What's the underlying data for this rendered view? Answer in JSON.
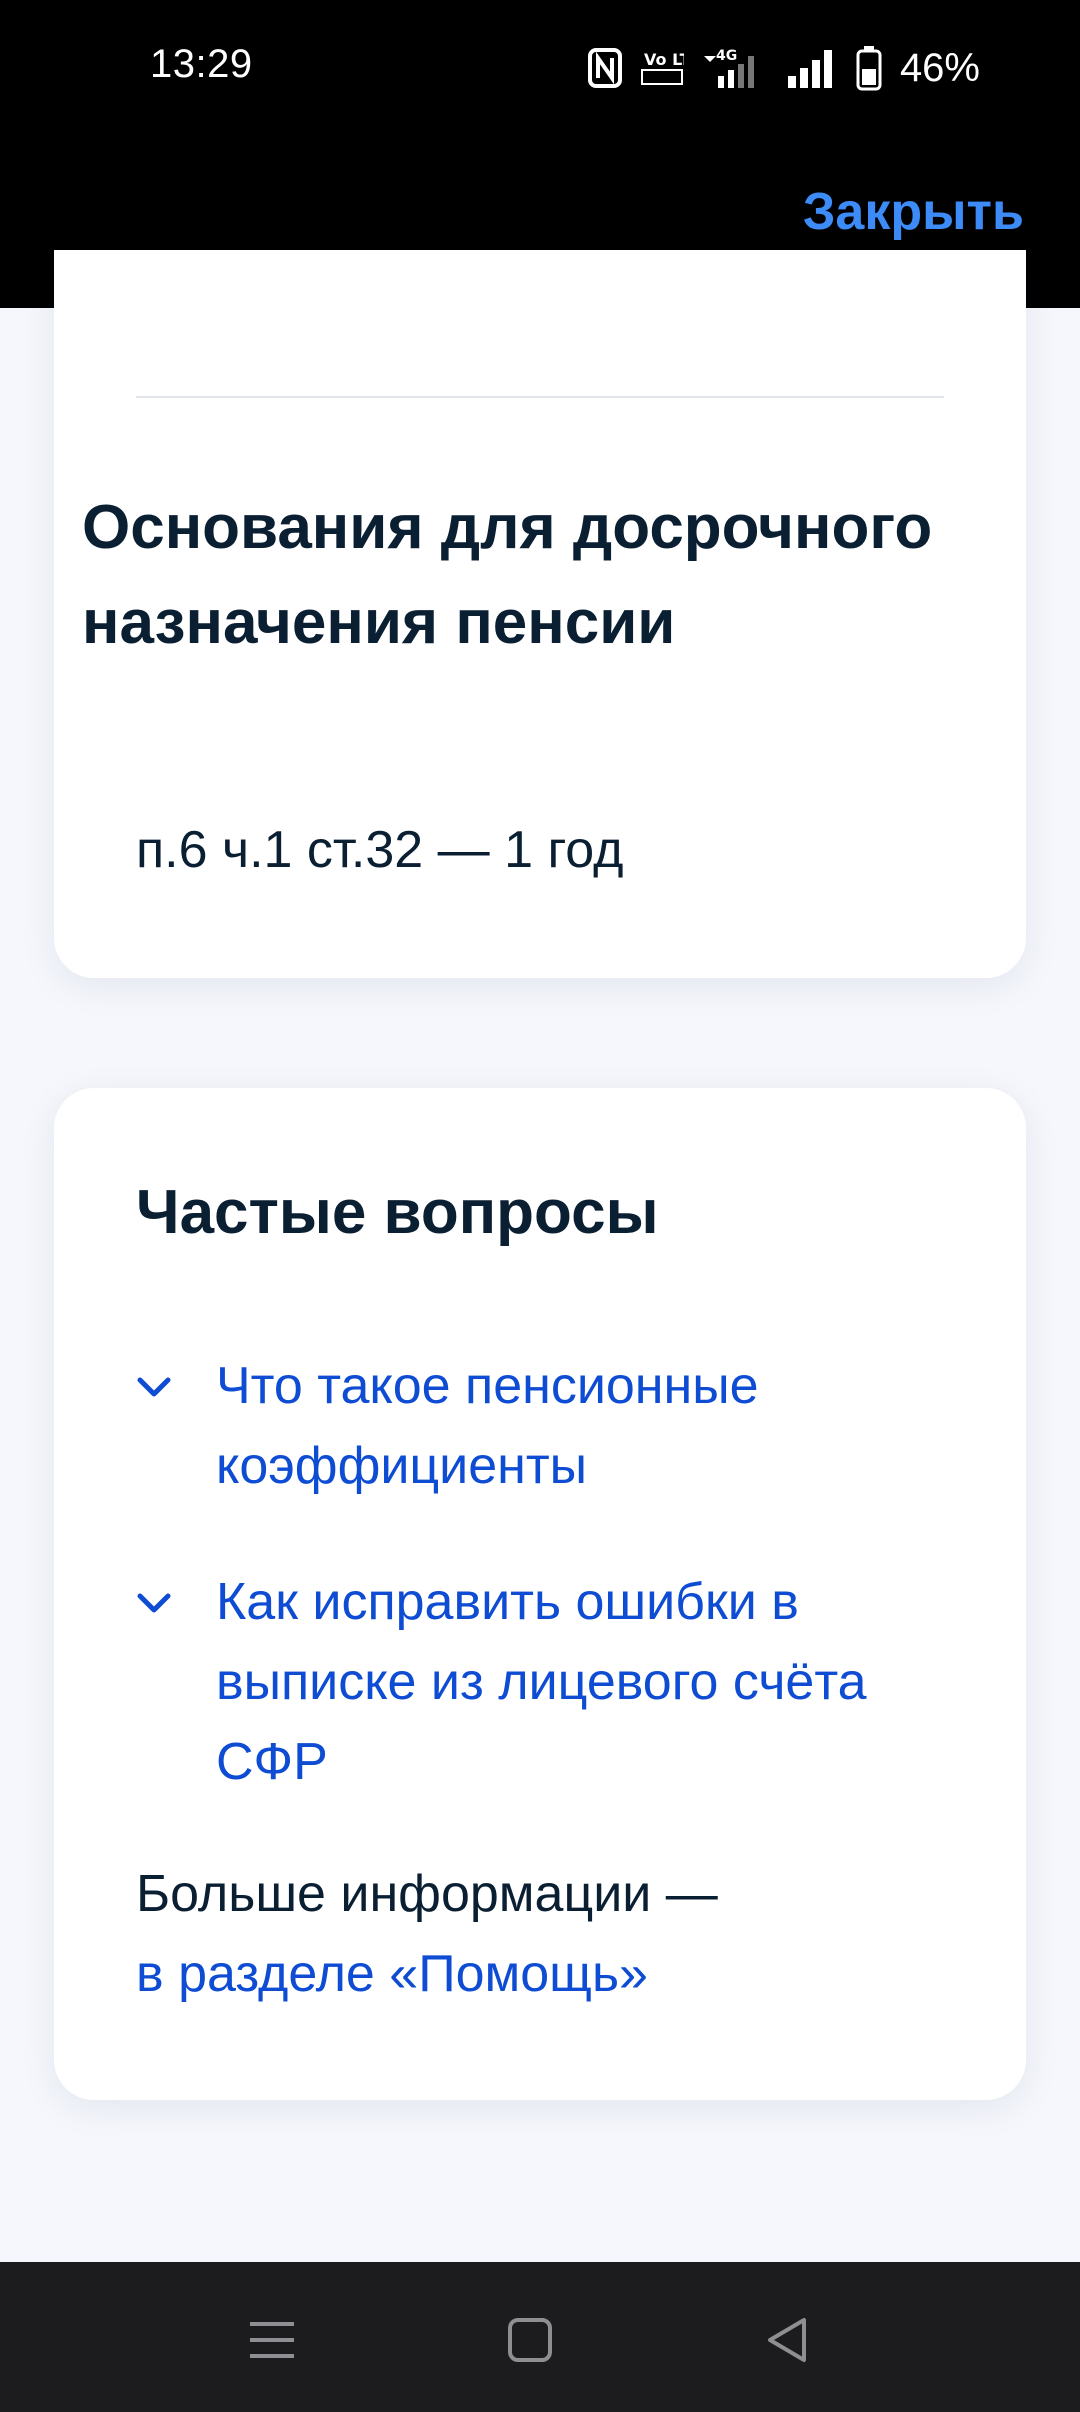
{
  "status_bar": {
    "time": "13:29",
    "battery_percent": "46%",
    "network_label": "4G",
    "volte_label": "Vo LTE",
    "icons": [
      "nfc-icon",
      "volte-icon",
      "signal-4g-icon",
      "signal-icon",
      "battery-icon"
    ]
  },
  "header": {
    "close_label": "Закрыть",
    "close_color": "#3d8bf7"
  },
  "early_pension": {
    "title": "Основания для досрочного назначения пенсии",
    "value": "п.6 ч.1 ст.32 — 1 год"
  },
  "faq": {
    "title": "Частые вопросы",
    "items": [
      {
        "label": "Что такое пенсионные коэффициенты",
        "icon": "chevron-down-icon"
      },
      {
        "label": "Как исправить ошибки в выписке из лицевого счёта СФР",
        "icon": "chevron-down-icon"
      }
    ],
    "more_info_text": "Больше информации —",
    "help_link": "в разделе «Помощь»",
    "link_color": "#0d4cd3"
  },
  "nav_bar": {
    "buttons": [
      "menu-icon",
      "home-icon",
      "back-icon"
    ]
  }
}
